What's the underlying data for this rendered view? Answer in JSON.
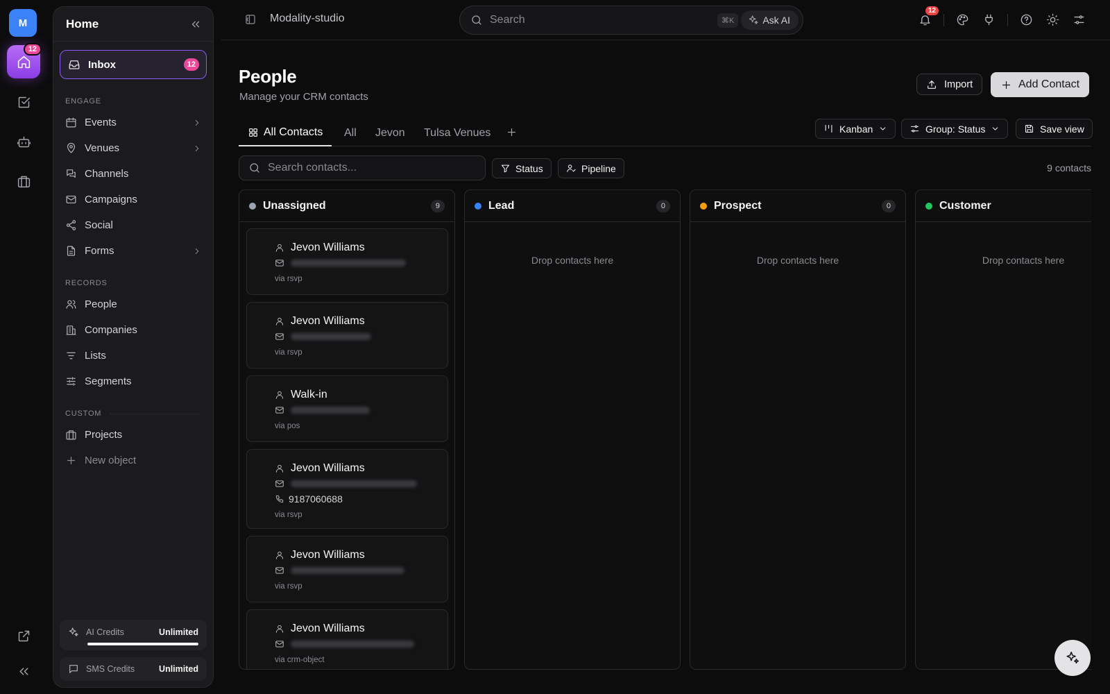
{
  "rail": {
    "workspace_initial": "M",
    "home_badge": "12"
  },
  "sidebar": {
    "title": "Home",
    "inbox": {
      "label": "Inbox",
      "badge": "12"
    },
    "sections": {
      "engage": "ENGAGE",
      "records": "RECORDS",
      "custom": "CUSTOM"
    },
    "engage_items": [
      {
        "label": "Events",
        "icon": "calendar-icon",
        "has_children": true
      },
      {
        "label": "Venues",
        "icon": "map-pin-icon",
        "has_children": true
      },
      {
        "label": "Channels",
        "icon": "chat-bubbles-icon",
        "has_children": false
      },
      {
        "label": "Campaigns",
        "icon": "mail-icon",
        "has_children": false
      },
      {
        "label": "Social",
        "icon": "share-icon",
        "has_children": false
      },
      {
        "label": "Forms",
        "icon": "document-icon",
        "has_children": true
      }
    ],
    "records_items": [
      {
        "label": "People",
        "icon": "users-icon"
      },
      {
        "label": "Companies",
        "icon": "building-icon"
      },
      {
        "label": "Lists",
        "icon": "list-icon"
      },
      {
        "label": "Segments",
        "icon": "sliders-icon"
      }
    ],
    "custom_items": [
      {
        "label": "Projects",
        "icon": "briefcase-icon"
      }
    ],
    "new_object": "New object",
    "ai_credits": {
      "label": "AI Credits",
      "value": "Unlimited",
      "fill": 1.0
    },
    "sms_credits": {
      "label": "SMS Credits",
      "value": "Unlimited"
    }
  },
  "topbar": {
    "title": "Modality-studio",
    "search_placeholder": "Search",
    "shortcut": "⌘K",
    "ask_ai": "Ask AI",
    "notif_badge": "12"
  },
  "page": {
    "title": "People",
    "subtitle": "Manage your CRM contacts",
    "import_label": "Import",
    "add_label": "Add Contact",
    "tabs": [
      "All Contacts",
      "All",
      "Jevon",
      "Tulsa Venues"
    ],
    "view_label": "Kanban",
    "group_label": "Group: Status",
    "save_view_label": "Save view",
    "contact_search_placeholder": "Search contacts...",
    "filter_status": "Status",
    "filter_pipeline": "Pipeline",
    "contact_count": "9 contacts"
  },
  "kanban": {
    "empty_text": "Drop contacts here",
    "columns": [
      {
        "title": "Unassigned",
        "count": "9",
        "color": "#9ca3af"
      },
      {
        "title": "Lead",
        "count": "0",
        "color": "#3b82f6"
      },
      {
        "title": "Prospect",
        "count": "0",
        "color": "#f59e0b"
      },
      {
        "title": "Customer",
        "count": "",
        "color": "#22c55e"
      }
    ],
    "cards": [
      {
        "name": "Jevon Williams",
        "phone": "",
        "source": "via rsvp"
      },
      {
        "name": "Jevon Williams",
        "phone": "",
        "source": "via rsvp"
      },
      {
        "name": "Walk-in",
        "phone": "",
        "source": "via pos"
      },
      {
        "name": "Jevon Williams",
        "phone": "9187060688",
        "source": "via rsvp"
      },
      {
        "name": "Jevon Williams",
        "phone": "",
        "source": "via rsvp"
      },
      {
        "name": "Jevon Williams",
        "phone": "",
        "source": "via crm-object"
      }
    ]
  }
}
